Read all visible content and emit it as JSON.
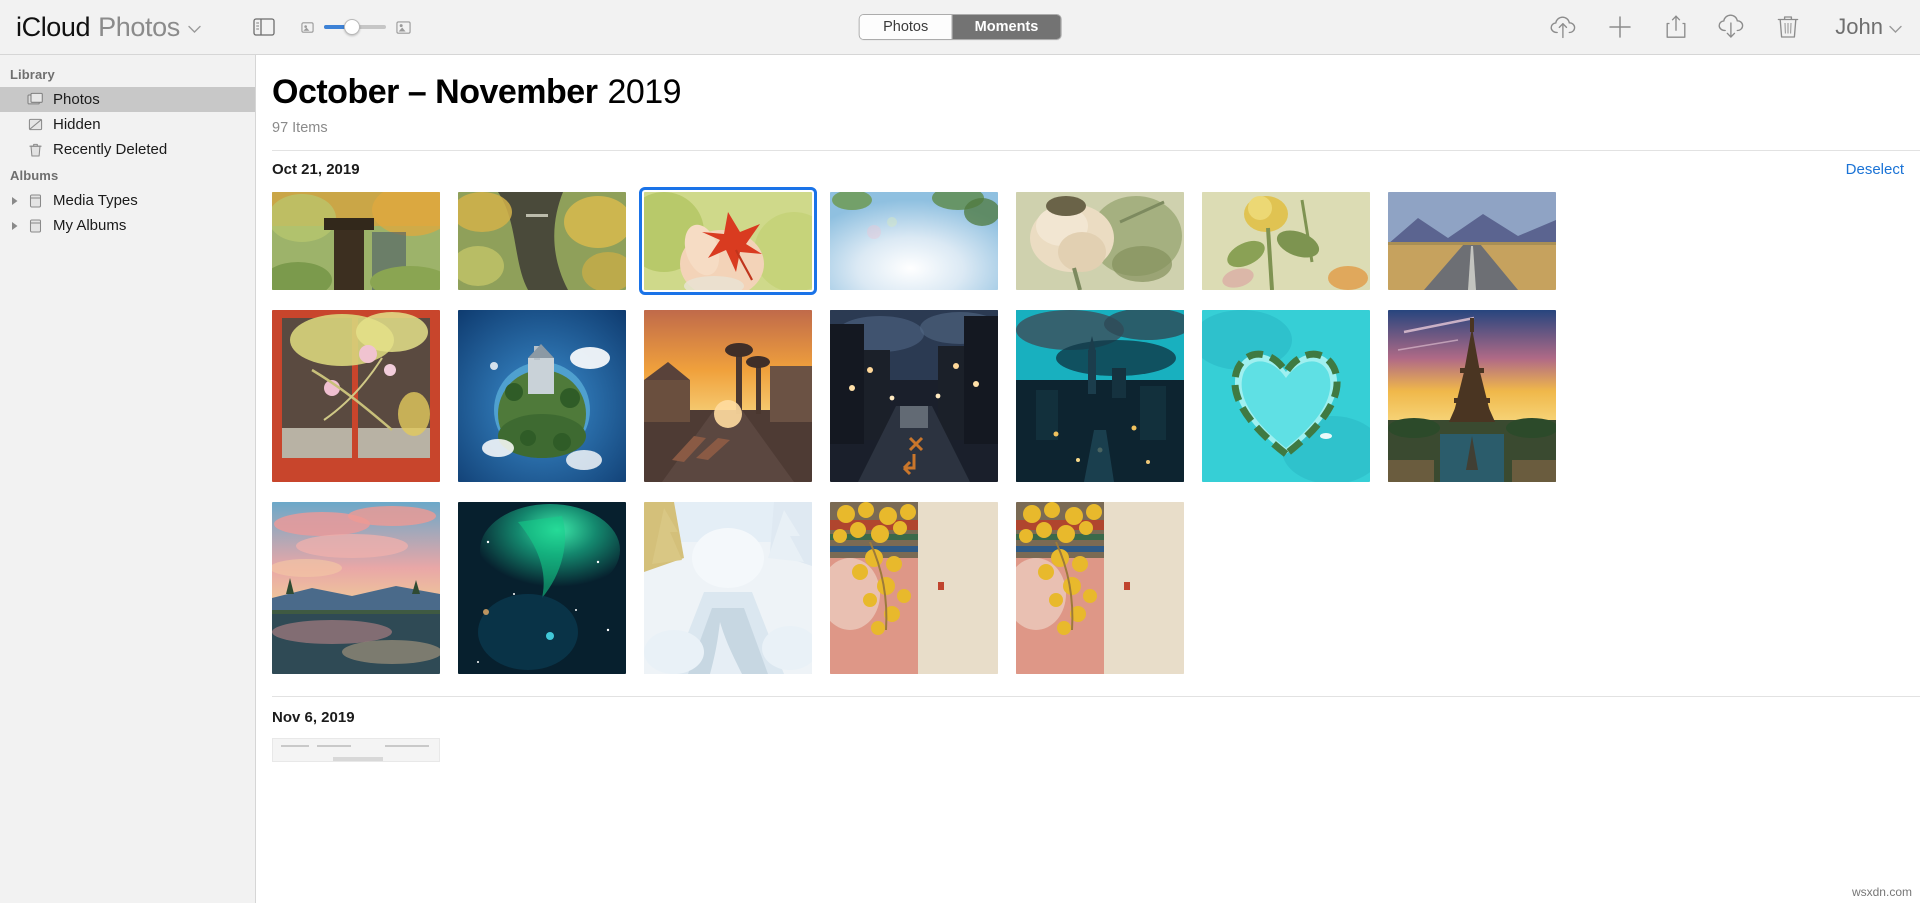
{
  "toolbar": {
    "app_brand": "iCloud",
    "app_section": "Photos",
    "title_caret": "chevron-down",
    "sidebar_toggle_icon": "sidebar-toggle-icon",
    "zoom_slider": {
      "small_icon": "small-thumbnail-icon",
      "large_icon": "large-thumbnail-icon",
      "value": 45
    },
    "segments": [
      {
        "label": "Photos",
        "active": false
      },
      {
        "label": "Moments",
        "active": true
      }
    ],
    "actions": [
      {
        "name": "upload-icon",
        "title": "Upload"
      },
      {
        "name": "add-icon",
        "title": "Add"
      },
      {
        "name": "share-icon",
        "title": "Share"
      },
      {
        "name": "download-icon",
        "title": "Download"
      },
      {
        "name": "trash-icon",
        "title": "Delete"
      }
    ],
    "user": {
      "name": "John",
      "caret": "chevron-down"
    }
  },
  "sidebar": {
    "groups": [
      {
        "label": "Library",
        "items": [
          {
            "label": "Photos",
            "icon": "photos-stack-icon",
            "selected": true,
            "disclosure": false
          },
          {
            "label": "Hidden",
            "icon": "hidden-icon",
            "selected": false,
            "disclosure": false
          },
          {
            "label": "Recently Deleted",
            "icon": "trash-icon",
            "selected": false,
            "disclosure": false
          }
        ]
      },
      {
        "label": "Albums",
        "items": [
          {
            "label": "Media Types",
            "icon": "album-icon",
            "selected": false,
            "disclosure": true
          },
          {
            "label": "My Albums",
            "icon": "album-icon",
            "selected": false,
            "disclosure": true
          }
        ]
      }
    ]
  },
  "main": {
    "title_strong": "October – November",
    "title_year": "2019",
    "item_count": "97 Items",
    "sections": [
      {
        "date": "Oct 21, 2019",
        "action_label": "Deselect",
        "photos": [
          {
            "name": "autumn-wooden-post",
            "orientation": "land",
            "selected": false,
            "colors": [
              "#9db36a",
              "#3c2f20",
              "#d9a23c"
            ]
          },
          {
            "name": "autumn-ivy-wall",
            "orientation": "land",
            "selected": false,
            "colors": [
              "#8fa05a",
              "#4a4a3a",
              "#d2b24a"
            ]
          },
          {
            "name": "red-maple-leaf-hand",
            "orientation": "land",
            "selected": true,
            "colors": [
              "#f3d3b8",
              "#d93b20",
              "#b8c96a"
            ]
          },
          {
            "name": "blue-sky-sun-flare",
            "orientation": "land",
            "selected": false,
            "colors": [
              "#9cc7e2",
              "#eef4f8",
              "#6f9a54"
            ]
          },
          {
            "name": "dried-white-rose",
            "orientation": "land",
            "selected": false,
            "colors": [
              "#ebdcc2",
              "#cbb48a",
              "#7d8a5f"
            ]
          },
          {
            "name": "yellow-rose-stem",
            "orientation": "land",
            "selected": false,
            "colors": [
              "#dcdcb4",
              "#e0c352",
              "#7f9352"
            ]
          },
          {
            "name": "desert-highway-road",
            "orientation": "land",
            "selected": false,
            "colors": [
              "#6f7aa0",
              "#c6a25e",
              "#4a4f70"
            ]
          }
        ]
      },
      {
        "photos_row2": [
          {
            "name": "cherry-blossom-window",
            "orientation": "port",
            "selected": false,
            "colors": [
              "#c8452c",
              "#5a4a40",
              "#e8bfc9"
            ]
          },
          {
            "name": "tiny-planet-castle",
            "orientation": "port",
            "selected": false,
            "colors": [
              "#12467e",
              "#3c8fd0",
              "#4f7a3a"
            ]
          },
          {
            "name": "sunset-palm-street",
            "orientation": "port",
            "selected": false,
            "colors": [
              "#e8913a",
              "#7a3f2a",
              "#2b1a14"
            ]
          },
          {
            "name": "night-city-street",
            "orientation": "port",
            "selected": false,
            "colors": [
              "#2b3a52",
              "#1a1f2b",
              "#d4872c"
            ]
          },
          {
            "name": "teal-city-skyline",
            "orientation": "port",
            "selected": false,
            "colors": [
              "#18b0bf",
              "#123040",
              "#d9a44f"
            ]
          },
          {
            "name": "heart-shaped-island",
            "orientation": "port",
            "selected": false,
            "colors": [
              "#36cfd6",
              "#9ff0f0",
              "#3f7a42"
            ]
          },
          {
            "name": "eiffel-tower-sunset",
            "orientation": "port",
            "selected": false,
            "colors": [
              "#27457e",
              "#f0b84a",
              "#4a3522"
            ]
          }
        ]
      },
      {
        "photos_row3": [
          {
            "name": "pink-clouds-lake",
            "orientation": "port",
            "selected": false,
            "colors": [
              "#e99a9a",
              "#6ba8c9",
              "#2f4a55"
            ]
          },
          {
            "name": "aurora-borealis-night",
            "orientation": "port",
            "selected": false,
            "colors": [
              "#0a1a28",
              "#14d08a",
              "#072030"
            ]
          },
          {
            "name": "snowy-winter-forest",
            "orientation": "port",
            "selected": false,
            "colors": [
              "#eef3f7",
              "#c7d7e2",
              "#d9c38a"
            ]
          },
          {
            "name": "ginkgo-wall-temple-a",
            "orientation": "port",
            "selected": false,
            "colors": [
              "#e8d9c4",
              "#e0b23a",
              "#d98a72"
            ]
          },
          {
            "name": "ginkgo-wall-temple-b",
            "orientation": "port",
            "selected": false,
            "colors": [
              "#e8d9c4",
              "#e0b23a",
              "#d98a72"
            ]
          }
        ]
      }
    ],
    "next_section": {
      "date": "Nov 6, 2019"
    }
  },
  "watermark": "wsxdn.com",
  "colors": {
    "accent_blue": "#1a73e8",
    "link_blue": "#1a73d6",
    "toolbar_bg": "#f2f2f2",
    "sidebar_selected": "#c8c8c8",
    "segment_active": "#737373"
  }
}
